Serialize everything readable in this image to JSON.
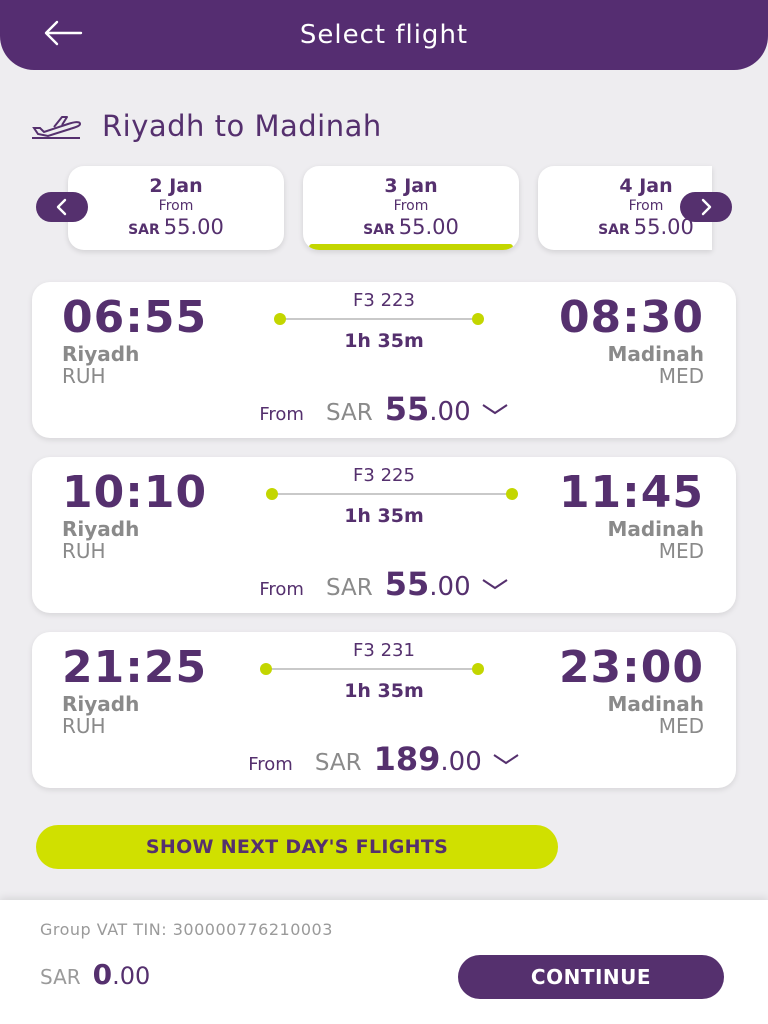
{
  "header": {
    "title": "Select flight",
    "back_icon": "arrow-left-icon"
  },
  "route": {
    "icon": "airplane-takeoff-icon",
    "text": "Riyadh to Madinah"
  },
  "dates": [
    {
      "date": "2 Jan",
      "from": "From",
      "currency": "SAR",
      "price": "55.00",
      "selected": false
    },
    {
      "date": "3 Jan",
      "from": "From",
      "currency": "SAR",
      "price": "55.00",
      "selected": true
    },
    {
      "date": "4 Jan",
      "from": "From",
      "currency": "SAR",
      "price": "55.00",
      "selected": false
    }
  ],
  "flights": [
    {
      "flight_no": "F3 223",
      "dep_time": "06:55",
      "arr_time": "08:30",
      "duration": "1h 35m",
      "dep_city": "Riyadh",
      "dep_code": "RUH",
      "arr_city": "Madinah",
      "arr_code": "MED",
      "from": "From",
      "currency": "SAR",
      "price_int": "55",
      "price_dec": ".00"
    },
    {
      "flight_no": "F3 225",
      "dep_time": "10:10",
      "arr_time": "11:45",
      "duration": "1h 35m",
      "dep_city": "Riyadh",
      "dep_code": "RUH",
      "arr_city": "Madinah",
      "arr_code": "MED",
      "from": "From",
      "currency": "SAR",
      "price_int": "55",
      "price_dec": ".00"
    },
    {
      "flight_no": "F3 231",
      "dep_time": "21:25",
      "arr_time": "23:00",
      "duration": "1h 35m",
      "dep_city": "Riyadh",
      "dep_code": "RUH",
      "arr_city": "Madinah",
      "arr_code": "MED",
      "from": "From",
      "currency": "SAR",
      "price_int": "189",
      "price_dec": ".00"
    }
  ],
  "next_day_label": "SHOW NEXT DAY'S FLIGHTS",
  "footer": {
    "vat": "Group VAT TIN: 300000776210003",
    "currency": "SAR",
    "total_int": "0",
    "total_dec": ".00",
    "continue_label": "CONTINUE"
  },
  "colors": {
    "primary": "#55306e",
    "accent": "#c3d600",
    "background": "#eeedf0"
  }
}
